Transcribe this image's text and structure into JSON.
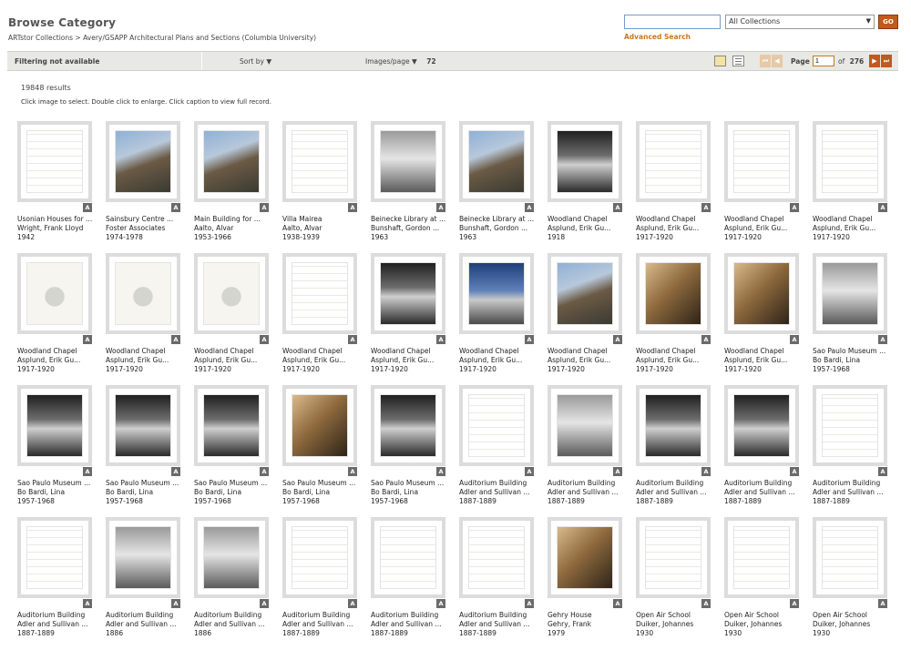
{
  "header": {
    "title": "Browse Category",
    "breadcrumb": "ARTstor Collections > Avery/GSAPP Architectural Plans and Sections (Columbia University)",
    "search_value": "",
    "collection_select": "All Collections",
    "go_label": "GO",
    "advanced_search": "Advanced Search"
  },
  "toolbar": {
    "filter_label": "Filtering not available",
    "sort_label": "Sort by",
    "images_per_page_label": "Images/page",
    "images_per_page_value": "72",
    "page_label": "Page",
    "page_value": "1",
    "of_label": "of",
    "total_pages": "276",
    "icons": [
      "folder-icon",
      "list-view-icon",
      "first-page-icon",
      "prev-page-icon",
      "next-page-icon",
      "last-page-icon"
    ]
  },
  "results_count": "19848 results",
  "instructions": "Click image to select. Double click to enlarge. Click caption to view full record.",
  "badge_label": "A",
  "items": [
    {
      "title": "Usonian Houses for ...",
      "creator": "Wright, Frank Lloyd",
      "date": "1942",
      "style": "drawing"
    },
    {
      "title": "Sainsbury Centre ...",
      "creator": "Foster Associates",
      "date": "1974-1978",
      "style": "photo"
    },
    {
      "title": "Main Building for ...",
      "creator": "Aalto, Alvar",
      "date": "1953-1966",
      "style": "photo"
    },
    {
      "title": "Villa Mairea",
      "creator": "Aalto, Alvar",
      "date": "1938-1939",
      "style": "drawing"
    },
    {
      "title": "Beinecke Library at ...",
      "creator": "Bunshaft, Gordon ...",
      "date": "1963",
      "style": "bwlight"
    },
    {
      "title": "Beinecke Library at ...",
      "creator": "Bunshaft, Gordon ...",
      "date": "1963",
      "style": "photo"
    },
    {
      "title": "Woodland Chapel",
      "creator": "Asplund, Erik Gu...",
      "date": "1918",
      "style": "bw"
    },
    {
      "title": "Woodland Chapel",
      "creator": "Asplund, Erik Gu...",
      "date": "1917-1920",
      "style": "drawing"
    },
    {
      "title": "Woodland Chapel",
      "creator": "Asplund, Erik Gu...",
      "date": "1917-1920",
      "style": "drawing"
    },
    {
      "title": "Woodland Chapel",
      "creator": "Asplund, Erik Gu...",
      "date": "1917-1920",
      "style": "drawing"
    },
    {
      "title": "Woodland Chapel",
      "creator": "Asplund, Erik Gu...",
      "date": "1917-1920",
      "style": "sketch"
    },
    {
      "title": "Woodland Chapel",
      "creator": "Asplund, Erik Gu...",
      "date": "1917-1920",
      "style": "sketch"
    },
    {
      "title": "Woodland Chapel",
      "creator": "Asplund, Erik Gu...",
      "date": "1917-1920",
      "style": "sketch"
    },
    {
      "title": "Woodland Chapel",
      "creator": "Asplund, Erik Gu...",
      "date": "1917-1920",
      "style": "drawing"
    },
    {
      "title": "Woodland Chapel",
      "creator": "Asplund, Erik Gu...",
      "date": "1917-1920",
      "style": "bw"
    },
    {
      "title": "Woodland Chapel",
      "creator": "Asplund, Erik Gu...",
      "date": "1917-1920",
      "style": "dusk"
    },
    {
      "title": "Woodland Chapel",
      "creator": "Asplund, Erik Gu...",
      "date": "1917-1920",
      "style": "photo"
    },
    {
      "title": "Woodland Chapel",
      "creator": "Asplund, Erik Gu...",
      "date": "1917-1920",
      "style": "interior"
    },
    {
      "title": "Woodland Chapel",
      "creator": "Asplund, Erik Gu...",
      "date": "1917-1920",
      "style": "interior"
    },
    {
      "title": "Sao Paulo Museum ...",
      "creator": "Bo Bardi, Lina",
      "date": "1957-1968",
      "style": "bwlight"
    },
    {
      "title": "Sao Paulo Museum ...",
      "creator": "Bo Bardi, Lina",
      "date": "1957-1968",
      "style": "bw"
    },
    {
      "title": "Sao Paulo Museum ...",
      "creator": "Bo Bardi, Lina",
      "date": "1957-1968",
      "style": "bw"
    },
    {
      "title": "Sao Paulo Museum ...",
      "creator": "Bo Bardi, Lina",
      "date": "1957-1968",
      "style": "bw"
    },
    {
      "title": "Sao Paulo Museum ...",
      "creator": "Bo Bardi, Lina",
      "date": "1957-1968",
      "style": "interior"
    },
    {
      "title": "Sao Paulo Museum ...",
      "creator": "Bo Bardi, Lina",
      "date": "1957-1968",
      "style": "bw"
    },
    {
      "title": "Auditorium Building",
      "creator": "Adler and Sullivan ...",
      "date": "1887-1889",
      "style": "drawing"
    },
    {
      "title": "Auditorium Building",
      "creator": "Adler and Sullivan ...",
      "date": "1887-1889",
      "style": "bwlight"
    },
    {
      "title": "Auditorium Building",
      "creator": "Adler and Sullivan ...",
      "date": "1887-1889",
      "style": "bw"
    },
    {
      "title": "Auditorium Building",
      "creator": "Adler and Sullivan ...",
      "date": "1887-1889",
      "style": "bw"
    },
    {
      "title": "Auditorium Building",
      "creator": "Adler and Sullivan ...",
      "date": "1887-1889",
      "style": "drawing"
    },
    {
      "title": "Auditorium Building",
      "creator": "Adler and Sullivan ...",
      "date": "1887-1889",
      "style": "drawing"
    },
    {
      "title": "Auditorium Building",
      "creator": "Adler and Sullivan ...",
      "date": "1886",
      "style": "bwlight"
    },
    {
      "title": "Auditorium Building",
      "creator": "Adler and Sullivan ...",
      "date": "1886",
      "style": "bwlight"
    },
    {
      "title": "Auditorium Building",
      "creator": "Adler and Sullivan ...",
      "date": "1887-1889",
      "style": "drawing"
    },
    {
      "title": "Auditorium Building",
      "creator": "Adler and Sullivan ...",
      "date": "1887-1889",
      "style": "drawing"
    },
    {
      "title": "Auditorium Building",
      "creator": "Adler and Sullivan ...",
      "date": "1887-1889",
      "style": "drawing"
    },
    {
      "title": "Gehry House",
      "creator": "Gehry, Frank",
      "date": "1979",
      "style": "interior"
    },
    {
      "title": "Open Air School",
      "creator": "Duiker, Johannes",
      "date": "1930",
      "style": "drawing"
    },
    {
      "title": "Open Air School",
      "creator": "Duiker, Johannes",
      "date": "1930",
      "style": "drawing"
    },
    {
      "title": "Open Air School",
      "creator": "Duiker, Johannes",
      "date": "1930",
      "style": "drawing"
    }
  ]
}
